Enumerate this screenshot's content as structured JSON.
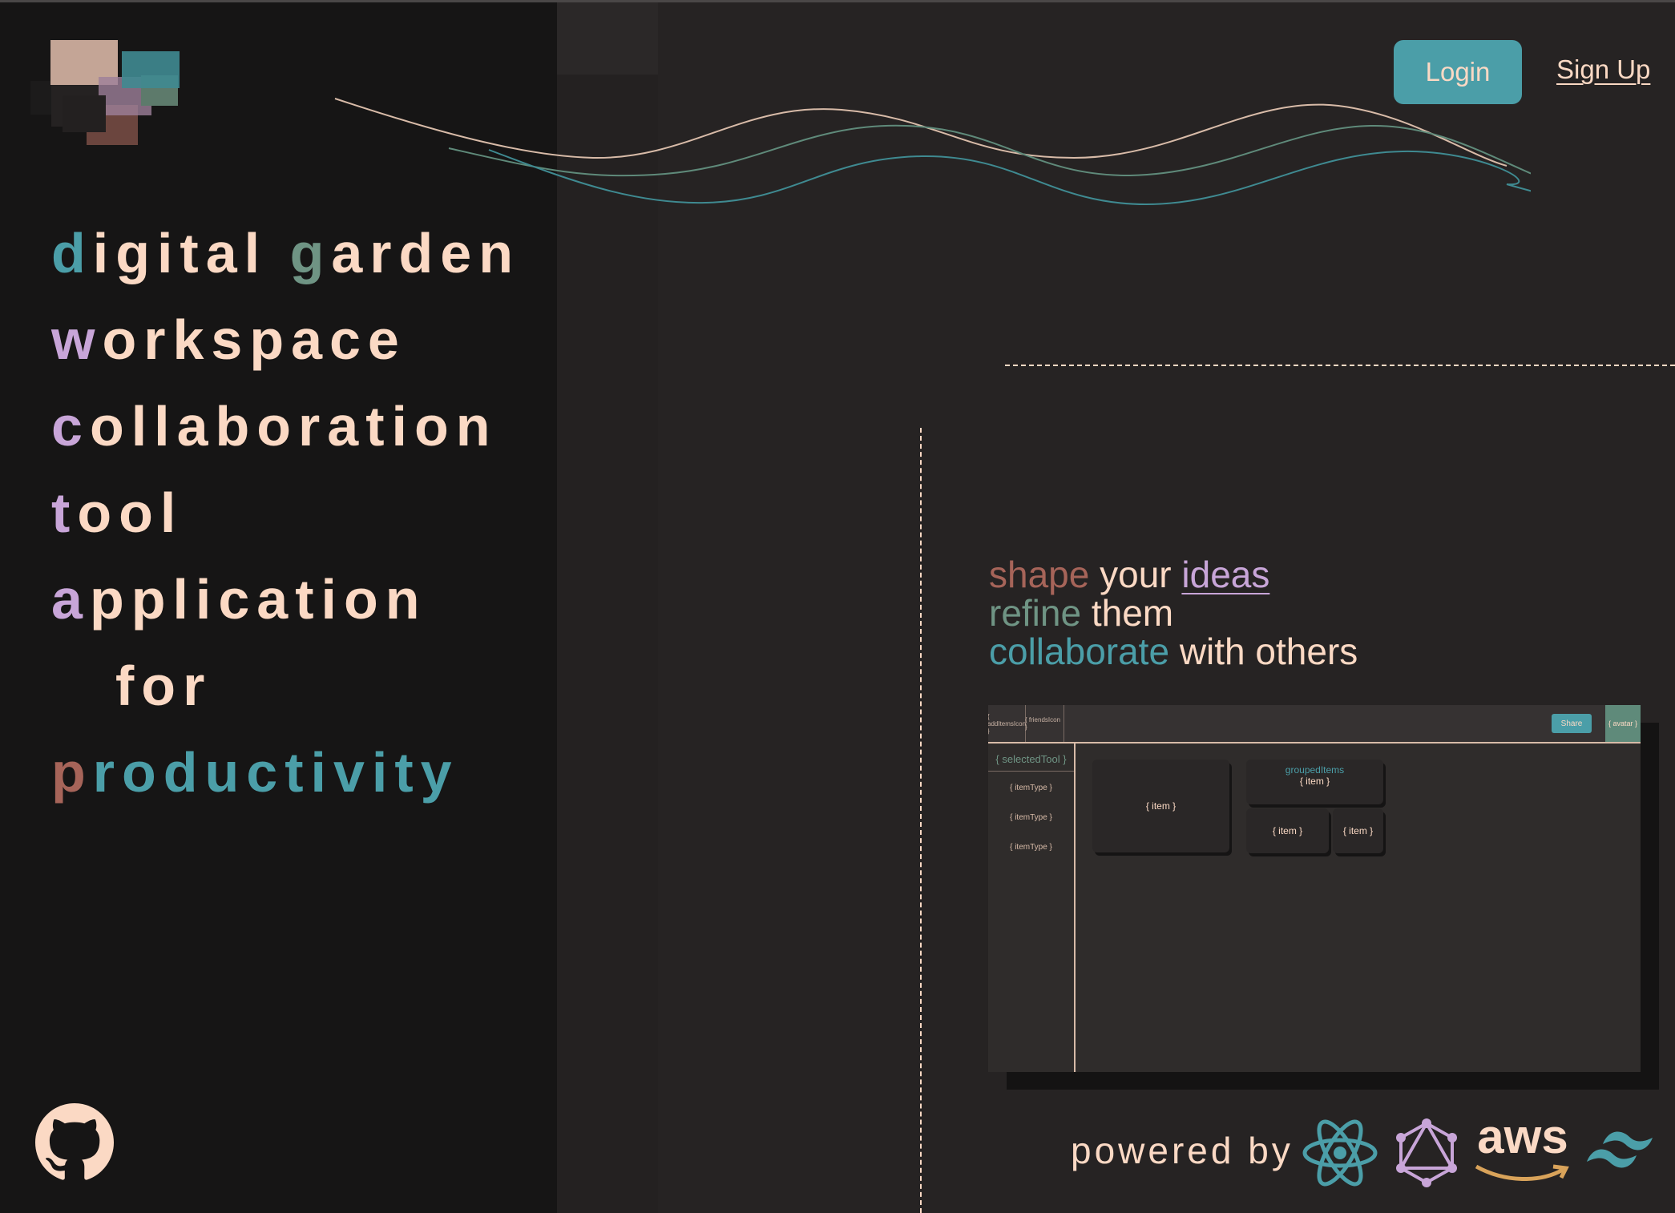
{
  "header": {
    "login_label": "Login",
    "signup_label": "Sign Up"
  },
  "headline": {
    "lines": [
      {
        "first": "d",
        "rest": "igital ",
        "second_first": "g",
        "second_rest": "arden",
        "first_color": "#4b9ea8",
        "second_color": "#6f9484"
      },
      {
        "first": "w",
        "rest": "orkspace",
        "first_color": "#c8a5d8"
      },
      {
        "first": "c",
        "rest": "ollaboration",
        "first_color": "#c8a5d8"
      },
      {
        "first": "t",
        "rest": "ool",
        "first_color": "#c8a5d8"
      },
      {
        "first": "a",
        "rest": "pplication",
        "first_color": "#c8a5d8"
      },
      {
        "first": "",
        "rest": "for",
        "first_color": "#fbd9c4"
      },
      {
        "first": "p",
        "rest": "roductivity",
        "first_color": "#a66459",
        "rest_color": "#4b9ea8"
      }
    ]
  },
  "tagline": {
    "line1": {
      "w1": "shape",
      "w2": " your ",
      "w3": "ideas"
    },
    "line2": {
      "w1": "refine",
      "w2": " them"
    },
    "line3": {
      "w1": "collaborate",
      "w2": " with others"
    }
  },
  "preview": {
    "tab1": "{ addItemsIcon }",
    "tab2": "{ friendsIcon }",
    "share_label": "Share",
    "avatar_label": "{ avatar }",
    "selected_tool": "{ selectedTool }",
    "item_types": [
      "{ itemType }",
      "{ itemType }",
      "{ itemType }"
    ],
    "item_label": "{ item }",
    "grouped_title": "groupedItems",
    "grouped_item": "{ item }",
    "small_item_1": "{ item }",
    "small_item_2": "{ item }"
  },
  "footer": {
    "powered_by": "powered by",
    "tech_icons": [
      "react-icon",
      "graphql-icon",
      "aws-icon",
      "tailwind-icon"
    ],
    "aws_label": "aws"
  },
  "colors": {
    "background": "#262323",
    "left_panel": "#161515",
    "accent_teal": "#4b9ea8",
    "accent_sage": "#6f9484",
    "accent_lilac": "#c8a5d8",
    "accent_rust": "#a66459",
    "text_peach": "#fbd9c4"
  }
}
